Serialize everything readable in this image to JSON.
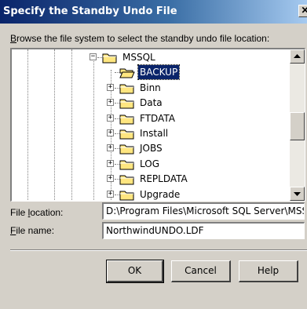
{
  "window": {
    "title": "Specify the Standby Undo File",
    "close_glyph": "✕"
  },
  "instruction": {
    "first_letter": "B",
    "rest": "rowse the file system to select the standby undo file location:"
  },
  "tree": {
    "items": [
      {
        "label": "MSSQL",
        "expander": "−",
        "icon": "folder-icon",
        "selected": false
      },
      {
        "label": "BACKUP",
        "expander": "",
        "icon": "open-folder-icon",
        "selected": true
      },
      {
        "label": "Binn",
        "expander": "+",
        "icon": "folder-icon",
        "selected": false
      },
      {
        "label": "Data",
        "expander": "+",
        "icon": "folder-icon",
        "selected": false
      },
      {
        "label": "FTDATA",
        "expander": "+",
        "icon": "folder-icon",
        "selected": false
      },
      {
        "label": "Install",
        "expander": "+",
        "icon": "folder-icon",
        "selected": false
      },
      {
        "label": "JOBS",
        "expander": "+",
        "icon": "folder-icon",
        "selected": false
      },
      {
        "label": "LOG",
        "expander": "+",
        "icon": "folder-icon",
        "selected": false
      },
      {
        "label": "REPLDATA",
        "expander": "+",
        "icon": "folder-icon",
        "selected": false
      },
      {
        "label": "Upgrade",
        "expander": "+",
        "icon": "folder-icon",
        "selected": false
      }
    ],
    "scroll_up_glyph": "▲",
    "scroll_down_glyph": "▼"
  },
  "fields": {
    "location": {
      "label_pre": "File ",
      "label_accel": "l",
      "label_post": "ocation:",
      "value": "D:\\Program Files\\Microsoft SQL Server\\MSSQL\\BACKUP\\"
    },
    "name": {
      "label_accel": "F",
      "label_post": "ile name:",
      "value": "NorthwindUNDO.LDF"
    }
  },
  "buttons": {
    "ok": "OK",
    "cancel": "Cancel",
    "help": "Help"
  },
  "colors": {
    "title_bar": "#0a246a",
    "selection": "#0a246a",
    "face": "#d4d0c8",
    "folder_yellow": "#ffe680"
  }
}
